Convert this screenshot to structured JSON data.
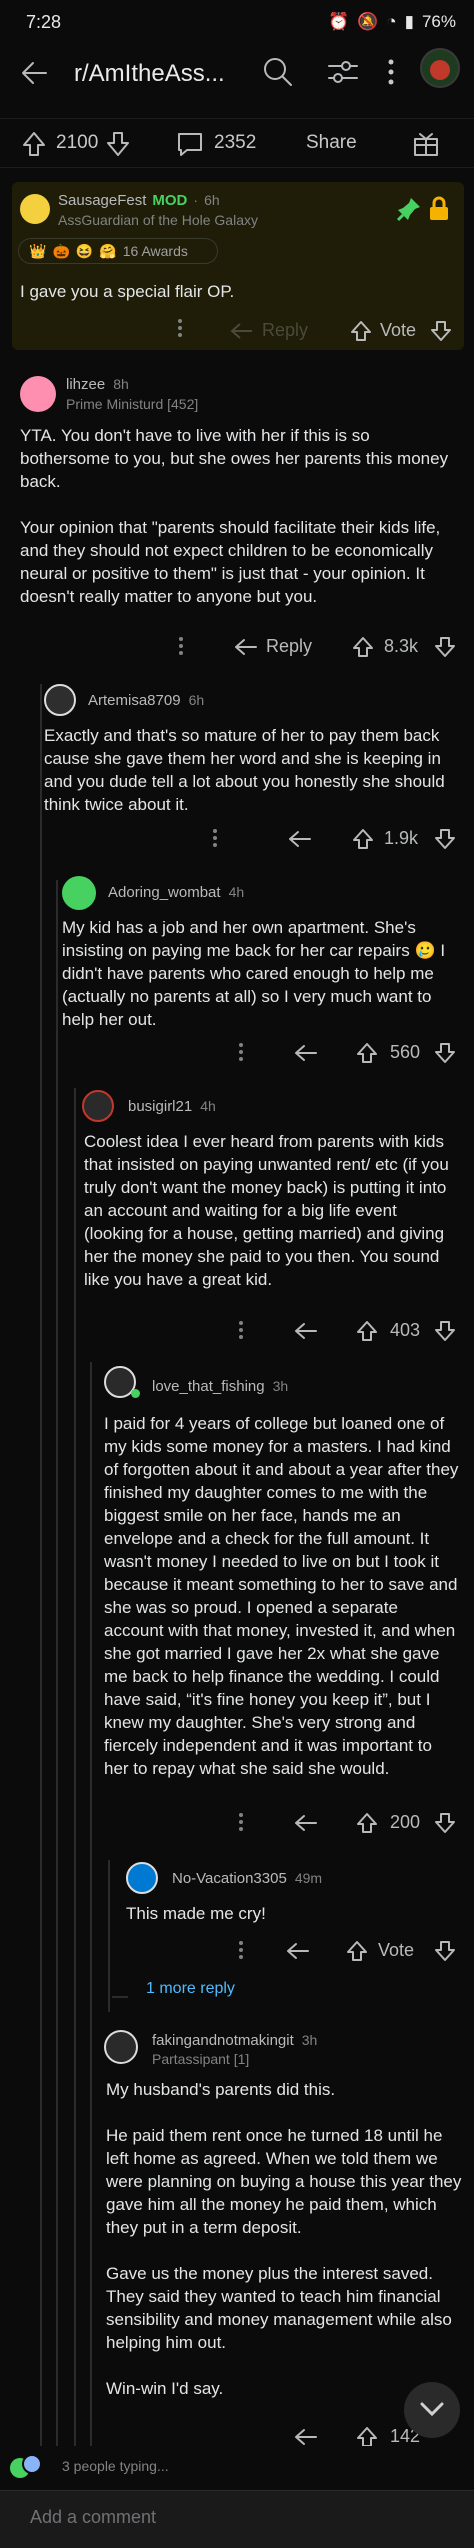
{
  "status_bar": {
    "time": "7:28",
    "battery": "76%"
  },
  "header": {
    "subreddit": "r/AmItheAss..."
  },
  "post_bar": {
    "upvotes": "2100",
    "comments": "2352",
    "share_label": "Share"
  },
  "comments": [
    {
      "user": "SausageFest",
      "mod_badge": "MOD",
      "age": "6h",
      "flair": "AssGuardian of the Hole Galaxy",
      "awards": "16 Awards",
      "text": "I gave you a special flair OP.",
      "reply_label": "Reply",
      "score": "Vote",
      "accent": "#2a2500"
    },
    {
      "user": "lihzee",
      "age": "8h",
      "flair": "Prime Ministurd [452]",
      "text": "YTA. You don't have to live with her if this is so bothersome to you, but she owes her parents this money back.\n\nYour opinion that \"parents should facilitate their kids life, and they should not expect children to be economically neural or positive to them\" is just that - your opinion. It doesn't really matter to anyone but you.",
      "reply_label": "Reply",
      "score": "8.3k"
    },
    {
      "user": "Artemisa8709",
      "age": "6h",
      "text": "Exactly and that's so mature of her to pay them back cause she gave them her word and she is keeping in and you dude tell a lot about you honestly she should think twice about it.",
      "score": "1.9k"
    },
    {
      "user": "Adoring_wombat",
      "age": "4h",
      "text": "My kid has a job and her own apartment. She's insisting on paying me back for her car repairs 🥲 I didn't have parents who cared enough to help me (actually no parents at all) so I very much want to help her out.",
      "score": "560"
    },
    {
      "user": "busigirl21",
      "age": "4h",
      "text": "Coolest idea I ever heard from parents with kids that insisted on paying unwanted rent/ etc (if you truly don't want the money back) is putting it into an account and waiting for a big life event (looking for a house, getting married) and giving her the money she paid to you then. You sound like you have a great kid.",
      "score": "403"
    },
    {
      "user": "love_that_fishing",
      "age": "3h",
      "text": "I paid for 4 years of college but loaned one of my kids some money for a masters. I had kind of forgotten about it and about a year after they finished my daughter comes to me with the biggest smile on her face, hands me an envelope and a check for the full amount. It wasn't money I needed to live on but I took it because it meant something to her to save and she was so proud. I opened a separate account with that money, invested it, and when she got married I gave her 2x what she gave me back to help finance the wedding. I could have said, “it's fine honey you keep it”, but I knew my daughter. She's very strong and fiercely independent and it was important to her to repay what she said she would.",
      "score": "200"
    },
    {
      "user": "No-Vacation3305",
      "age": "49m",
      "text": "This made me cry!",
      "score": "Vote",
      "more_replies": "1 more reply"
    },
    {
      "user": "fakingandnotmakingit",
      "age": "3h",
      "flair": "Partassipant [1]",
      "text": "My husband's parents did this.\n\nHe paid them rent once he turned 18 until he left home as agreed. When we told them we were planning on buying a house this year they gave him all the money he paid them, which they put in a term deposit.\n\nGave us the money plus the interest saved. They said they wanted to teach him financial sensibility and money management while also helping him out.\n\nWin-win I'd say.",
      "score": "142"
    }
  ],
  "footer": {
    "typing": "3 people typing...",
    "placeholder": "Add a comment"
  }
}
